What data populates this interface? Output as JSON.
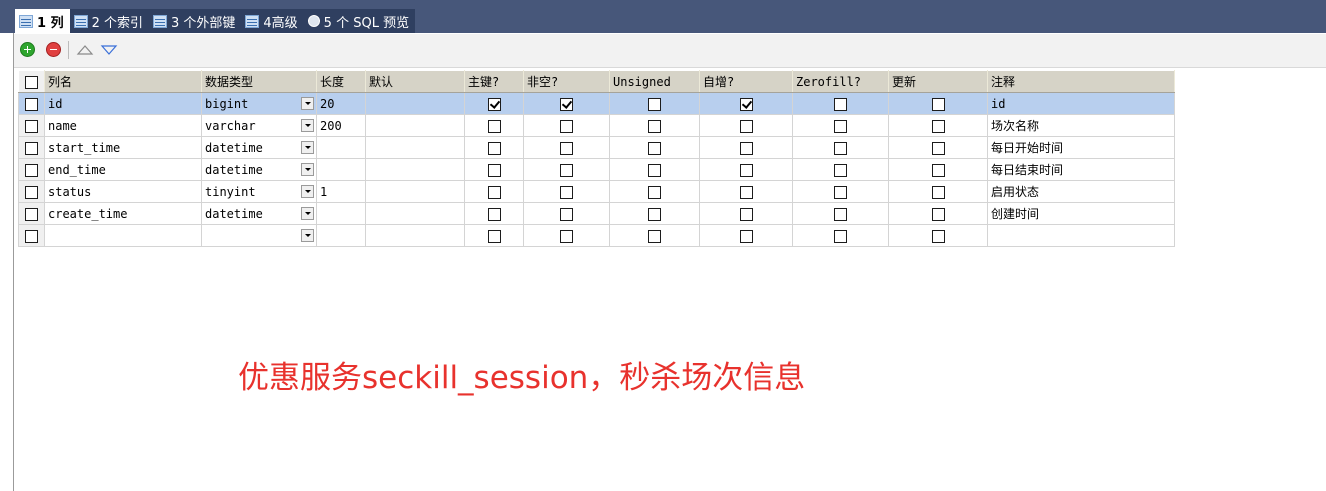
{
  "tabs": [
    {
      "label": "1 列",
      "icon": "columns-icon",
      "active": true
    },
    {
      "label": "2 个索引",
      "icon": "index-icon",
      "active": false
    },
    {
      "label": "3 个外部键",
      "icon": "foreign-key-icon",
      "active": false
    },
    {
      "label": "4高级",
      "icon": "advanced-icon",
      "active": false
    },
    {
      "label": "5 个 SQL 预览",
      "icon": "sql-preview-icon",
      "active": false
    }
  ],
  "toolbar": {
    "add_icon": "add-row-icon",
    "delete_icon": "delete-row-icon",
    "up_icon": "move-up-icon",
    "down_icon": "move-down-icon"
  },
  "grid": {
    "headers": [
      "列名",
      "数据类型",
      "长度",
      "默认",
      "主键?",
      "非空?",
      "Unsigned",
      "自增?",
      "Zerofill?",
      "更新",
      "注释"
    ],
    "rows": [
      {
        "name": "id",
        "type": "bigint",
        "length": "20",
        "default": "",
        "pk": true,
        "notnull": true,
        "unsigned": false,
        "autoinc": true,
        "zerofill": false,
        "update": false,
        "comment": "id",
        "selected": true
      },
      {
        "name": "name",
        "type": "varchar",
        "length": "200",
        "default": "",
        "pk": false,
        "notnull": false,
        "unsigned": false,
        "autoinc": false,
        "zerofill": false,
        "update": false,
        "comment": "场次名称",
        "selected": false
      },
      {
        "name": "start_time",
        "type": "datetime",
        "length": "",
        "default": "",
        "pk": false,
        "notnull": false,
        "unsigned": false,
        "autoinc": false,
        "zerofill": false,
        "update": false,
        "comment": "每日开始时间",
        "selected": false
      },
      {
        "name": "end_time",
        "type": "datetime",
        "length": "",
        "default": "",
        "pk": false,
        "notnull": false,
        "unsigned": false,
        "autoinc": false,
        "zerofill": false,
        "update": false,
        "comment": "每日结束时间",
        "selected": false
      },
      {
        "name": "status",
        "type": "tinyint",
        "length": "1",
        "default": "",
        "pk": false,
        "notnull": false,
        "unsigned": false,
        "autoinc": false,
        "zerofill": false,
        "update": false,
        "comment": "启用状态",
        "selected": false
      },
      {
        "name": "create_time",
        "type": "datetime",
        "length": "",
        "default": "",
        "pk": false,
        "notnull": false,
        "unsigned": false,
        "autoinc": false,
        "zerofill": false,
        "update": false,
        "comment": "创建时间",
        "selected": false
      },
      {
        "name": "",
        "type": "",
        "length": "",
        "default": "",
        "pk": false,
        "notnull": false,
        "unsigned": false,
        "autoinc": false,
        "zerofill": false,
        "update": false,
        "comment": "",
        "selected": false
      }
    ]
  },
  "annotation": "优惠服务seckill_session，秒杀场次信息",
  "colors": {
    "tabbar": "#47577a",
    "selected_row": "#b8cfee",
    "annotation": "#e8322d",
    "header": "#d6d3c7"
  }
}
